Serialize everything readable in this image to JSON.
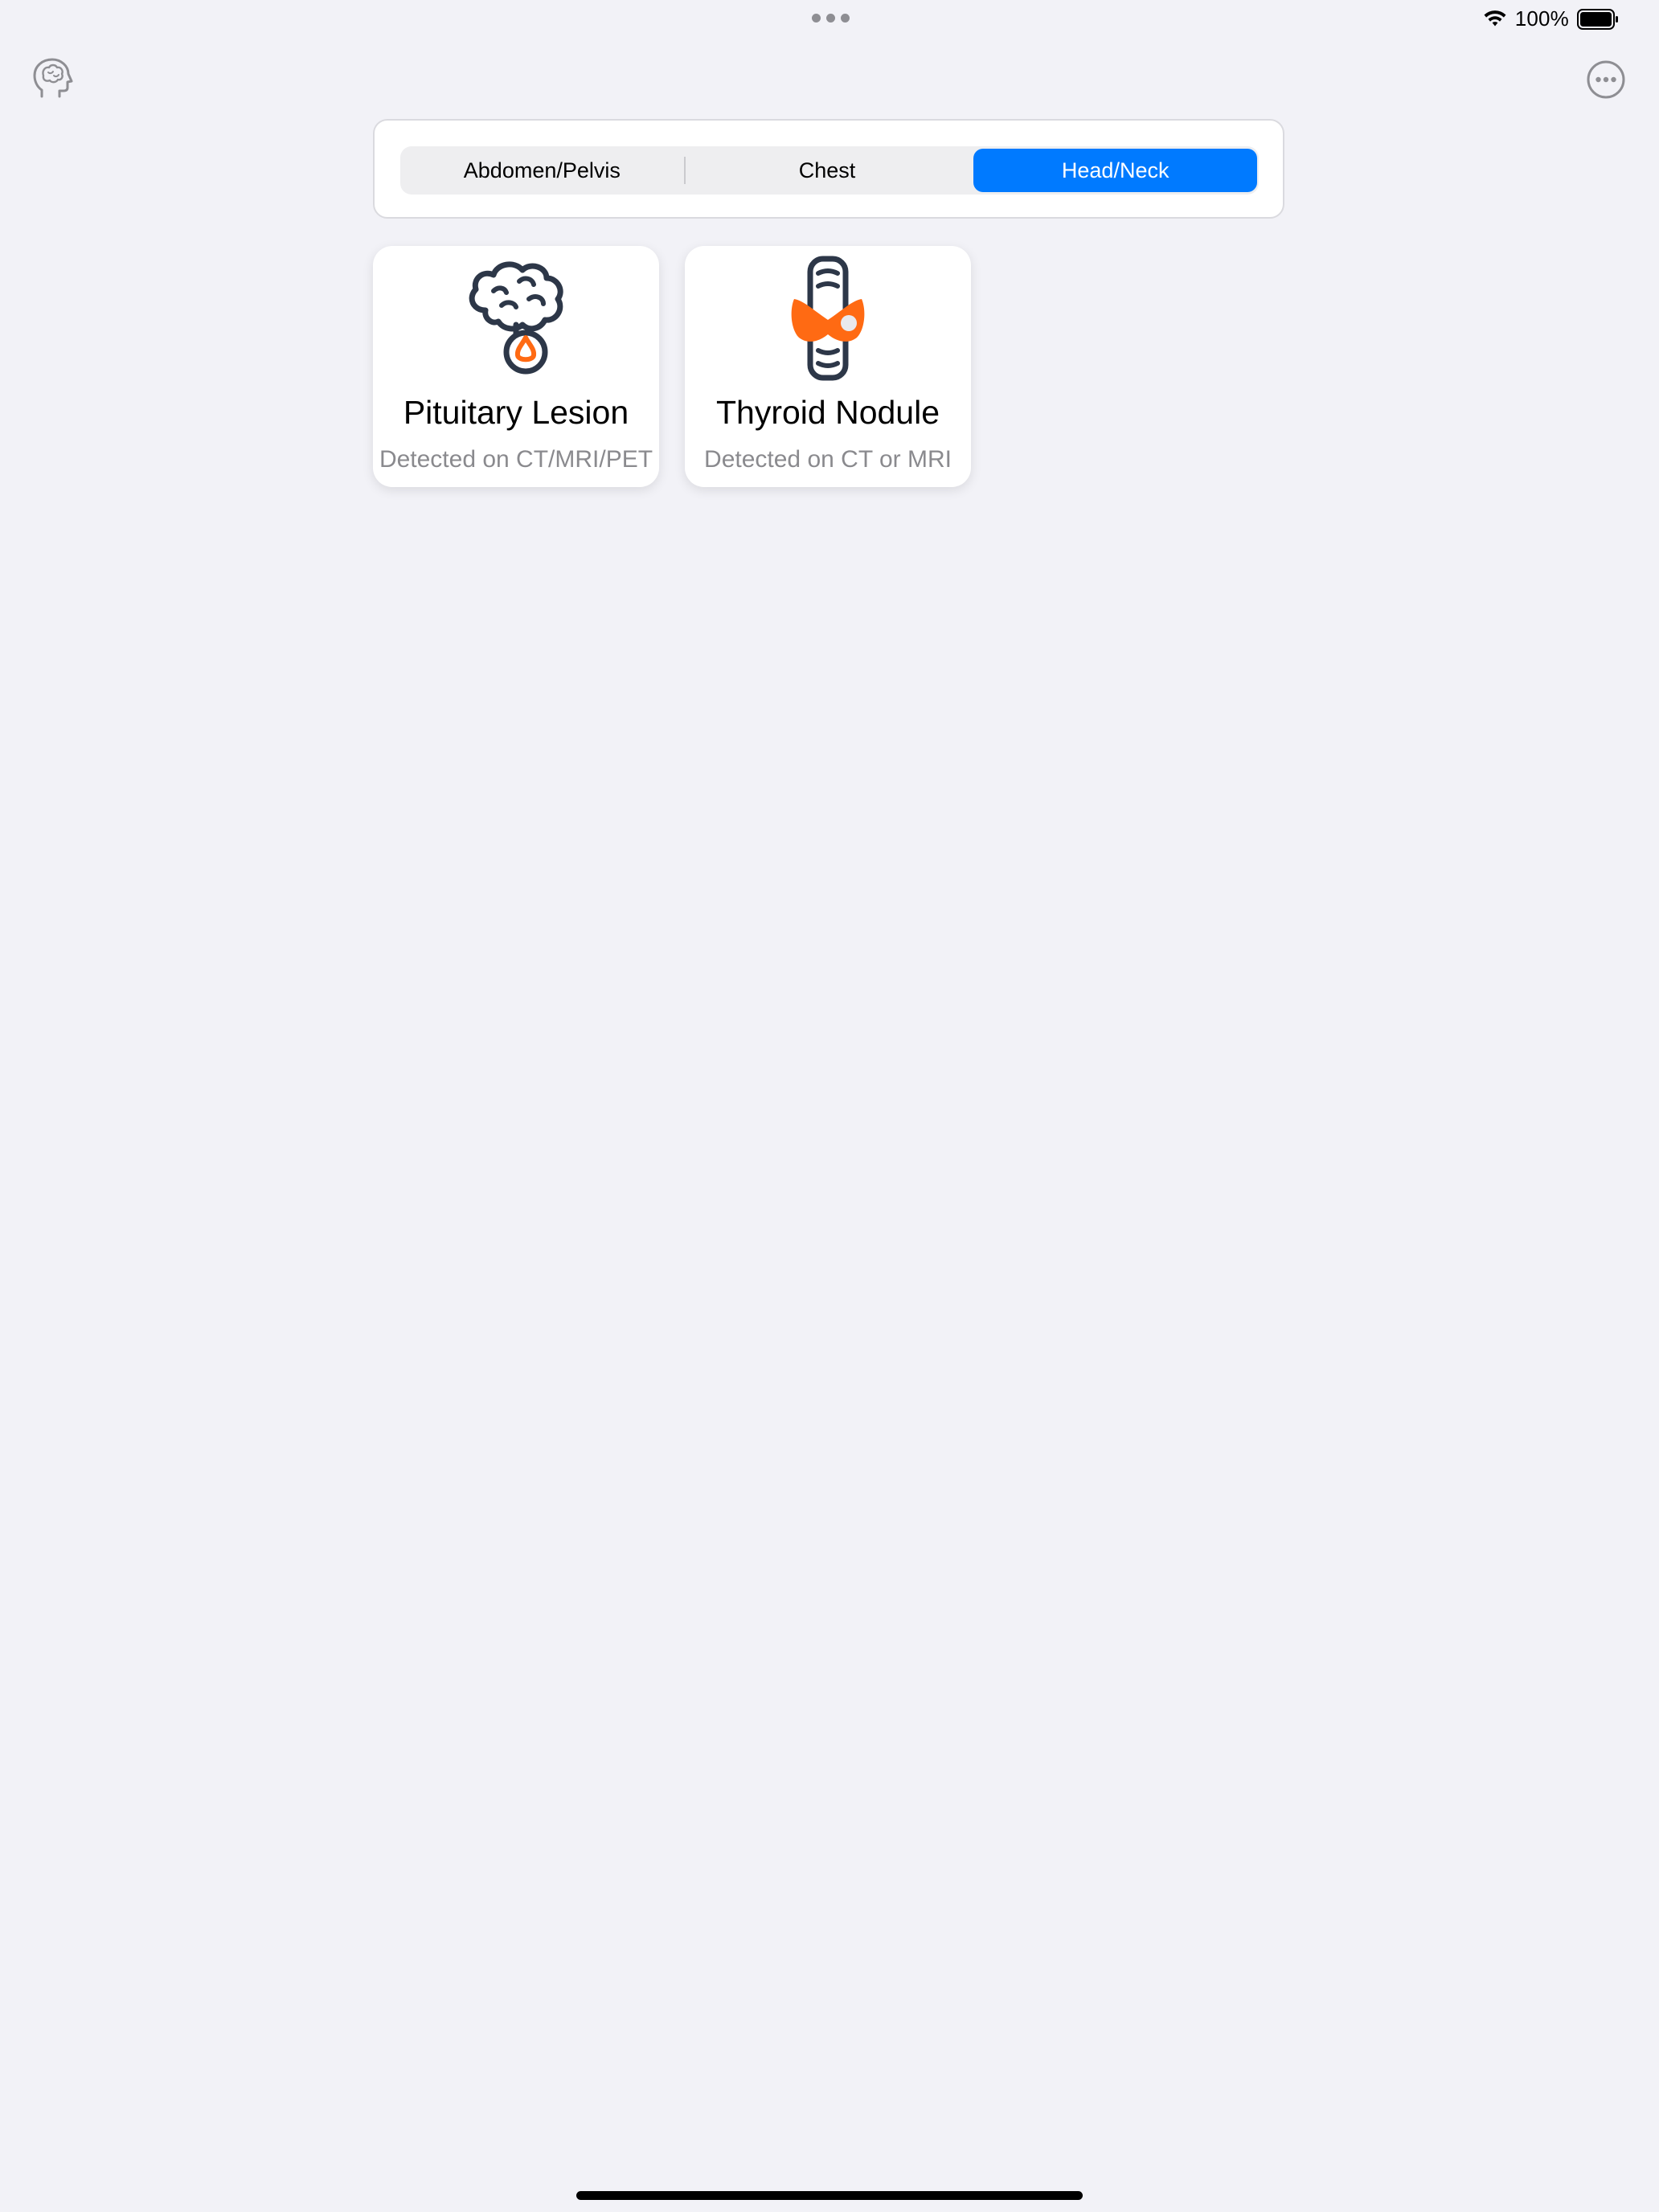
{
  "status_bar": {
    "battery_percent": "100%",
    "icons": [
      "wifi-icon",
      "battery-icon"
    ]
  },
  "nav": {
    "left_icon": "brain-head-icon",
    "right_icon": "more-ellipsis-icon"
  },
  "segments": [
    {
      "label": "Abdomen/Pelvis",
      "selected": false
    },
    {
      "label": "Chest",
      "selected": false
    },
    {
      "label": "Head/Neck",
      "selected": true
    }
  ],
  "cards": [
    {
      "title": "Pituitary Lesion",
      "subtitle": "Detected on CT/MRI/PET",
      "icon": "brain-pituitary-icon"
    },
    {
      "title": "Thyroid Nodule",
      "subtitle": "Detected on CT or MRI",
      "icon": "thyroid-icon"
    }
  ],
  "colors": {
    "accent": "#007AFF",
    "background": "#F2F2F7",
    "icon_dark": "#2D3748",
    "icon_orange": "#FF6A13",
    "subtitle": "#8A8A8E"
  }
}
